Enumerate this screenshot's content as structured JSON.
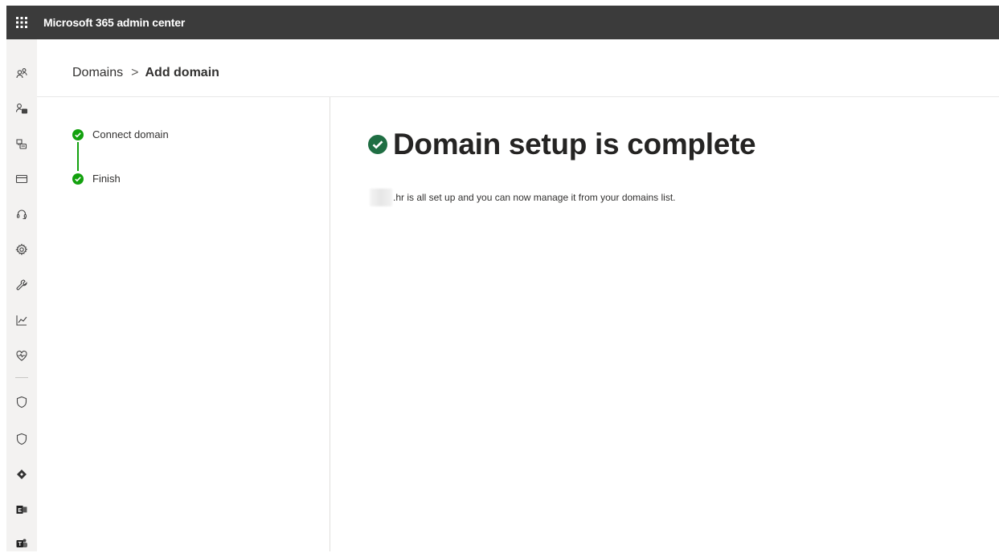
{
  "app": {
    "title": "Microsoft 365 admin center"
  },
  "colors": {
    "topbar": "#3b3b3b",
    "rail": "#f3f2f1",
    "success_green": "#13a10e",
    "headline_check": "#1f6e43"
  },
  "left_rail": {
    "icons": [
      "users-icon",
      "contacts-icon",
      "groups-icon",
      "billing-icon",
      "support-headset-icon",
      "settings-gear-icon",
      "setup-wrench-icon",
      "reports-chart-icon",
      "health-heart-icon",
      "security-shield-icon",
      "compliance-shield-icon",
      "endpoint-manager-icon",
      "exchange-icon",
      "teams-icon"
    ]
  },
  "breadcrumb": {
    "parent": "Domains",
    "separator": ">",
    "current": "Add domain"
  },
  "steps": [
    {
      "label": "Connect domain",
      "status": "complete"
    },
    {
      "label": "Finish",
      "status": "complete"
    }
  ],
  "main": {
    "headline": "Domain setup is complete",
    "message": ".hr is all set up and you can now manage it from your domains list."
  }
}
